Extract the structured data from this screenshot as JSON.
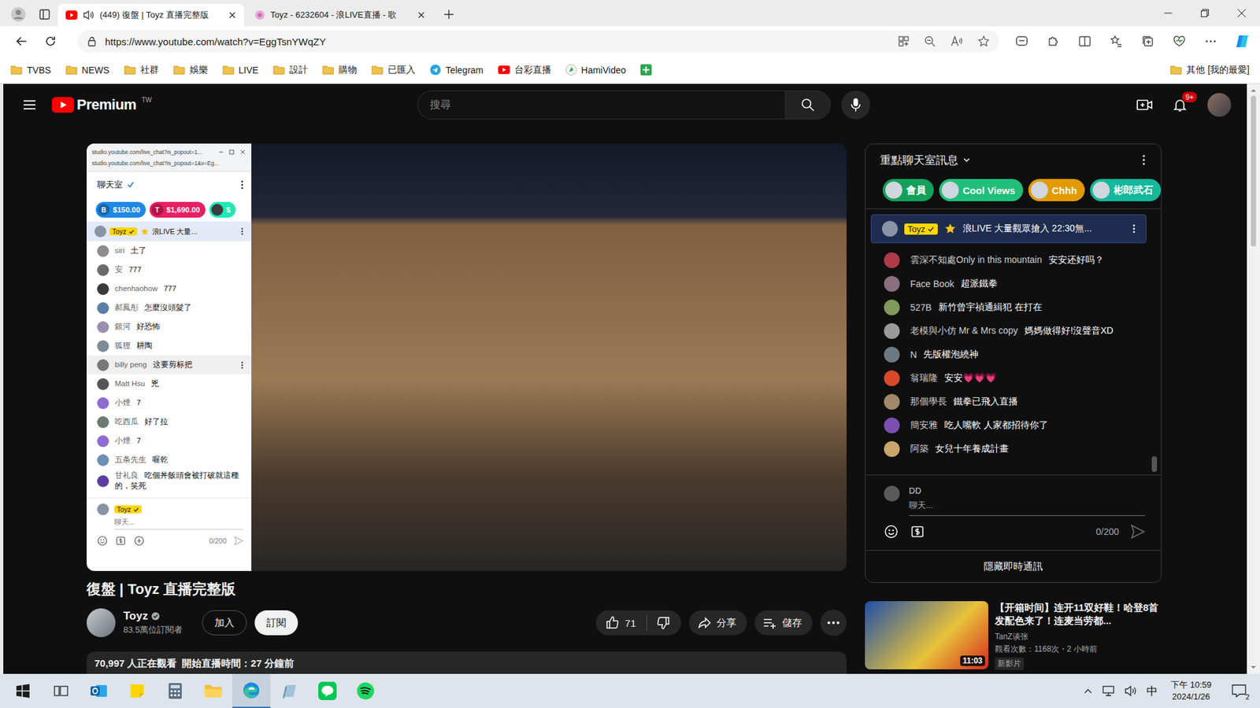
{
  "browser": {
    "tabs": [
      {
        "title": "(449) 復盤 | Toyz 直播完整版",
        "favicon": "youtube",
        "playing_audio": true,
        "selected": true
      },
      {
        "title": "Toyz - 6232604 - 浪LIVE直播 - 歌",
        "favicon": "flower",
        "playing_audio": false,
        "selected": false
      }
    ],
    "url": "https://www.youtube.com/watch?v=EggTsnYWqZY",
    "bookmarks": [
      {
        "label": "TVBS",
        "kind": "folder"
      },
      {
        "label": "NEWS",
        "kind": "folder"
      },
      {
        "label": "社群",
        "kind": "folder"
      },
      {
        "label": "娛樂",
        "kind": "folder"
      },
      {
        "label": "LIVE",
        "kind": "folder"
      },
      {
        "label": "設計",
        "kind": "folder"
      },
      {
        "label": "購物",
        "kind": "folder"
      },
      {
        "label": "已匯入",
        "kind": "folder"
      },
      {
        "label": "Telegram",
        "kind": "telegram"
      },
      {
        "label": "台彩直播",
        "kind": "youtube"
      },
      {
        "label": "HamiVideo",
        "kind": "hami"
      }
    ],
    "other_bookmarks": "其他 [我的最愛]"
  },
  "youtube": {
    "logo": "Premium",
    "region": "TW",
    "search_placeholder": "搜尋",
    "notification_count": "9+",
    "video": {
      "title": "復盤 | Toyz 直播完整版",
      "channel": "Toyz",
      "verified": true,
      "subscribers": "83.5萬位訂閱者",
      "join_label": "加入",
      "subscribe_label": "訂閱",
      "subscribed": false,
      "likes": "71",
      "liked": false,
      "share_label": "分享",
      "save_label": "儲存",
      "viewers": "70,997 人正在觀看",
      "started": "開始直播時間：27 分鐘前"
    },
    "embedded_chat": {
      "url_lines": [
        "studio.youtube.com/live_chat?is_popout=1...",
        "studio.youtube.com/live_chat?is_popout=1&v=Eg..."
      ],
      "title": "聊天室",
      "chips": [
        {
          "amount": "$150.00",
          "kind": "letter",
          "initial": "B",
          "color": "#1e88e5"
        },
        {
          "amount": "$1,690.00",
          "kind": "letter",
          "initial": "T",
          "color": "#e91e63"
        },
        {
          "amount": "$",
          "kind": "avatar",
          "initial": "",
          "color": "#1de9b6"
        }
      ],
      "pinned": {
        "author": "Toyz",
        "text": "浪LIVE 大量..."
      },
      "messages": [
        {
          "author": "siri",
          "text": "土了",
          "hover": false,
          "color": "#8d8d8d"
        },
        {
          "author": "安",
          "text": "777",
          "hover": false,
          "color": "#6b6b6b"
        },
        {
          "author": "chenhaohow",
          "text": "777",
          "hover": false,
          "color": "#3a3a3a"
        },
        {
          "author": "郝鳳彤",
          "text": "怎麼沒頭髮了",
          "hover": false,
          "color": "#5c7fa8"
        },
        {
          "author": "銀河",
          "text": "好恐怖",
          "hover": false,
          "color": "#9a8fb0"
        },
        {
          "author": "狐狸",
          "text": "耕陶",
          "hover": false,
          "color": "#7e8a96"
        },
        {
          "author": "billy peng",
          "text": "这要剪标把",
          "hover": true,
          "color": "#777777"
        },
        {
          "author": "Matt Hsu",
          "text": "兇",
          "hover": false,
          "color": "#555555"
        },
        {
          "author": "小煙",
          "text": "7",
          "hover": false,
          "color": "#8e6bd1"
        },
        {
          "author": "吃西瓜",
          "text": "好了拉",
          "hover": false,
          "color": "#6d7a70"
        },
        {
          "author": "小煙",
          "text": "7",
          "hover": false,
          "color": "#8e6bd1"
        },
        {
          "author": "五条先生",
          "text": "喔乾",
          "hover": false,
          "color": "#6f8fb5"
        },
        {
          "author": "甘礼良",
          "text": "吃個丼飯頭會被打破就這種的，笑死",
          "hover": false,
          "color": "#5b3fa0"
        }
      ],
      "input": {
        "author": "Toyz",
        "placeholder": "聊天...",
        "counter": "0/200"
      }
    }
  },
  "live_chat": {
    "title": "重點聊天室訊息",
    "chips": [
      {
        "label": "會員",
        "color": "#13a05a"
      },
      {
        "label": "Cool Views",
        "color": "#1fbf7a"
      },
      {
        "label": "Chhh",
        "color": "#e39a00"
      },
      {
        "label": "彬郎武石",
        "color": "#14b89a"
      }
    ],
    "pinned": {
      "author": "Toyz",
      "text": "浪LIVE 大量觀眾搶入 22:30無..."
    },
    "messages": [
      {
        "author": "雲深不知處Only in this mountain",
        "text": "安安还好吗？",
        "color": "#b03a48"
      },
      {
        "author": "Face Book",
        "text": "超派鐵拳",
        "color": "#8a6f7e"
      },
      {
        "author": "527B",
        "text": "新竹曾宇禎通緝犯 在打在",
        "color": "#7f9a5a"
      },
      {
        "author": "老模與小仿 Mr & Mrs copy",
        "text": "媽媽做得好!沒聲音XD",
        "color": "#9a9a9a"
      },
      {
        "author": "N",
        "text": "先版權泡繞神",
        "color": "#6a7a80"
      },
      {
        "author": "翁瑞隆",
        "text": "安安💗💗💗",
        "color": "#d9482b"
      },
      {
        "author": "那個學長",
        "text": "鐵拳已飛入直播",
        "color": "#a08a6a"
      },
      {
        "author": "簡安雅",
        "text": "吃人嘴軟 人家都招待你了",
        "color": "#7a4fb0"
      },
      {
        "author": "阿築",
        "text": "女兒十年養成計畫",
        "color": "#c9a66b"
      }
    ],
    "input": {
      "author": "DD",
      "placeholder": "聊天...",
      "counter": "0/200"
    },
    "hide_button": "隱藏即時通訊"
  },
  "recommendations": [
    {
      "title": "【开箱时间】连开11双好鞋！哈登8首发配色来了！连麦当劳都...",
      "channel": "TanZ谈张",
      "meta": "觀看次數：1168次・2 小時前",
      "badge": "新影片",
      "duration": "11:03"
    }
  ],
  "taskbar": {
    "apps": [
      {
        "kind": "task-view",
        "active": false
      },
      {
        "kind": "outlook",
        "active": false
      },
      {
        "kind": "sticky-notes",
        "active": false
      },
      {
        "kind": "calculator",
        "active": false
      },
      {
        "kind": "explorer",
        "active": false
      },
      {
        "kind": "edge",
        "active": true
      },
      {
        "kind": "notepad",
        "active": false
      },
      {
        "kind": "line",
        "active": false
      },
      {
        "kind": "spotify",
        "active": false
      }
    ],
    "ime": "中",
    "time": "下午 10:59",
    "date": "2024/1/26",
    "notification_count": "2"
  }
}
